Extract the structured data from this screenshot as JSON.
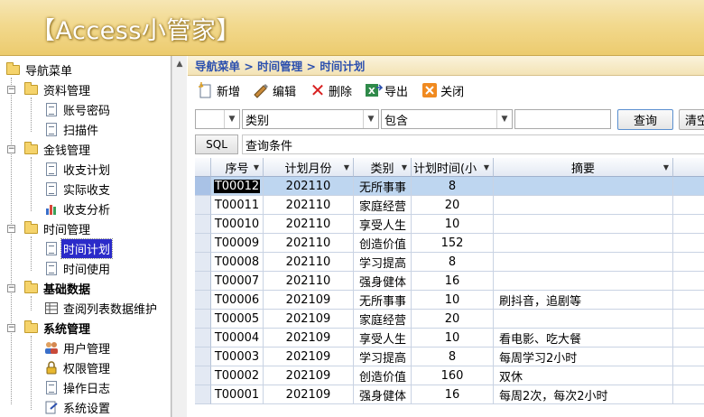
{
  "app": {
    "title": "【Access小管家】"
  },
  "tree": {
    "items": [
      {
        "label": "导航菜单",
        "icon": "folder-open-icon"
      },
      {
        "label": "资料管理",
        "icon": "folder-open-icon"
      },
      {
        "label": "账号密码",
        "icon": "document-icon"
      },
      {
        "label": "扫描件",
        "icon": "document-icon"
      },
      {
        "label": "金钱管理",
        "icon": "folder-open-icon"
      },
      {
        "label": "收支计划",
        "icon": "document-icon"
      },
      {
        "label": "实际收支",
        "icon": "document-icon"
      },
      {
        "label": "收支分析",
        "icon": "bar-chart-icon"
      },
      {
        "label": "时间管理",
        "icon": "folder-open-icon"
      },
      {
        "label": "时间计划",
        "icon": "document-icon"
      },
      {
        "label": "时间使用",
        "icon": "document-icon"
      },
      {
        "label": "基础数据",
        "icon": "folder-open-icon"
      },
      {
        "label": "查阅列表数据维护",
        "icon": "table-icon"
      },
      {
        "label": "系统管理",
        "icon": "folder-open-icon"
      },
      {
        "label": "用户管理",
        "icon": "users-icon"
      },
      {
        "label": "权限管理",
        "icon": "lock-icon"
      },
      {
        "label": "操作日志",
        "icon": "document-icon"
      },
      {
        "label": "系统设置",
        "icon": "settings-document-icon"
      }
    ]
  },
  "breadcrumb": "导航菜单 > 时间管理 > 时间计划",
  "toolbar": {
    "new_label": "新增",
    "edit_label": "编辑",
    "delete_label": "删除",
    "export_label": "导出",
    "close_label": "关闭"
  },
  "filter": {
    "field_value": "类别",
    "operator_value": "包含",
    "query_label": "查询",
    "clear_label": "清空"
  },
  "sql": {
    "button_label": "SQL",
    "condition_label": "查询条件"
  },
  "grid": {
    "columns": [
      "序号",
      "计划月份",
      "类别",
      "计划时间(小",
      "摘要"
    ],
    "rows": [
      {
        "id": "T00012",
        "month": "202110",
        "category": "无所事事",
        "hours": "8",
        "summary": ""
      },
      {
        "id": "T00011",
        "month": "202110",
        "category": "家庭经营",
        "hours": "20",
        "summary": ""
      },
      {
        "id": "T00010",
        "month": "202110",
        "category": "享受人生",
        "hours": "10",
        "summary": ""
      },
      {
        "id": "T00009",
        "month": "202110",
        "category": "创造价值",
        "hours": "152",
        "summary": ""
      },
      {
        "id": "T00008",
        "month": "202110",
        "category": "学习提高",
        "hours": "8",
        "summary": ""
      },
      {
        "id": "T00007",
        "month": "202110",
        "category": "强身健体",
        "hours": "16",
        "summary": ""
      },
      {
        "id": "T00006",
        "month": "202109",
        "category": "无所事事",
        "hours": "10",
        "summary": "刷抖音，追剧等"
      },
      {
        "id": "T00005",
        "month": "202109",
        "category": "家庭经营",
        "hours": "20",
        "summary": ""
      },
      {
        "id": "T00004",
        "month": "202109",
        "category": "享受人生",
        "hours": "10",
        "summary": "看电影、吃大餐"
      },
      {
        "id": "T00003",
        "month": "202109",
        "category": "学习提高",
        "hours": "8",
        "summary": "每周学习2小时"
      },
      {
        "id": "T00002",
        "month": "202109",
        "category": "创造价值",
        "hours": "160",
        "summary": "双休"
      },
      {
        "id": "T00001",
        "month": "202109",
        "category": "强身健体",
        "hours": "16",
        "summary": "每周2次，每次2小时"
      }
    ]
  },
  "colors": {
    "banner": "#f2d98e",
    "breadcrumb_text": "#2b4fae",
    "selection": "#2b2bc9",
    "row_selected": "#bed6f0"
  }
}
